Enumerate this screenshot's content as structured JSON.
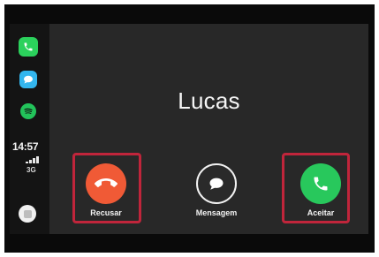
{
  "status": {
    "time": "14:57",
    "network": "3G"
  },
  "dock": {
    "apps": [
      {
        "name": "phone-app-icon"
      },
      {
        "name": "messages-app-icon"
      },
      {
        "name": "spotify-app-icon"
      }
    ]
  },
  "call": {
    "caller_name": "Lucas",
    "decline_label": "Recusar",
    "message_label": "Mensagem",
    "accept_label": "Aceitar"
  },
  "colors": {
    "decline": "#f05a36",
    "accept": "#28c85c",
    "highlight": "#c0253b"
  }
}
